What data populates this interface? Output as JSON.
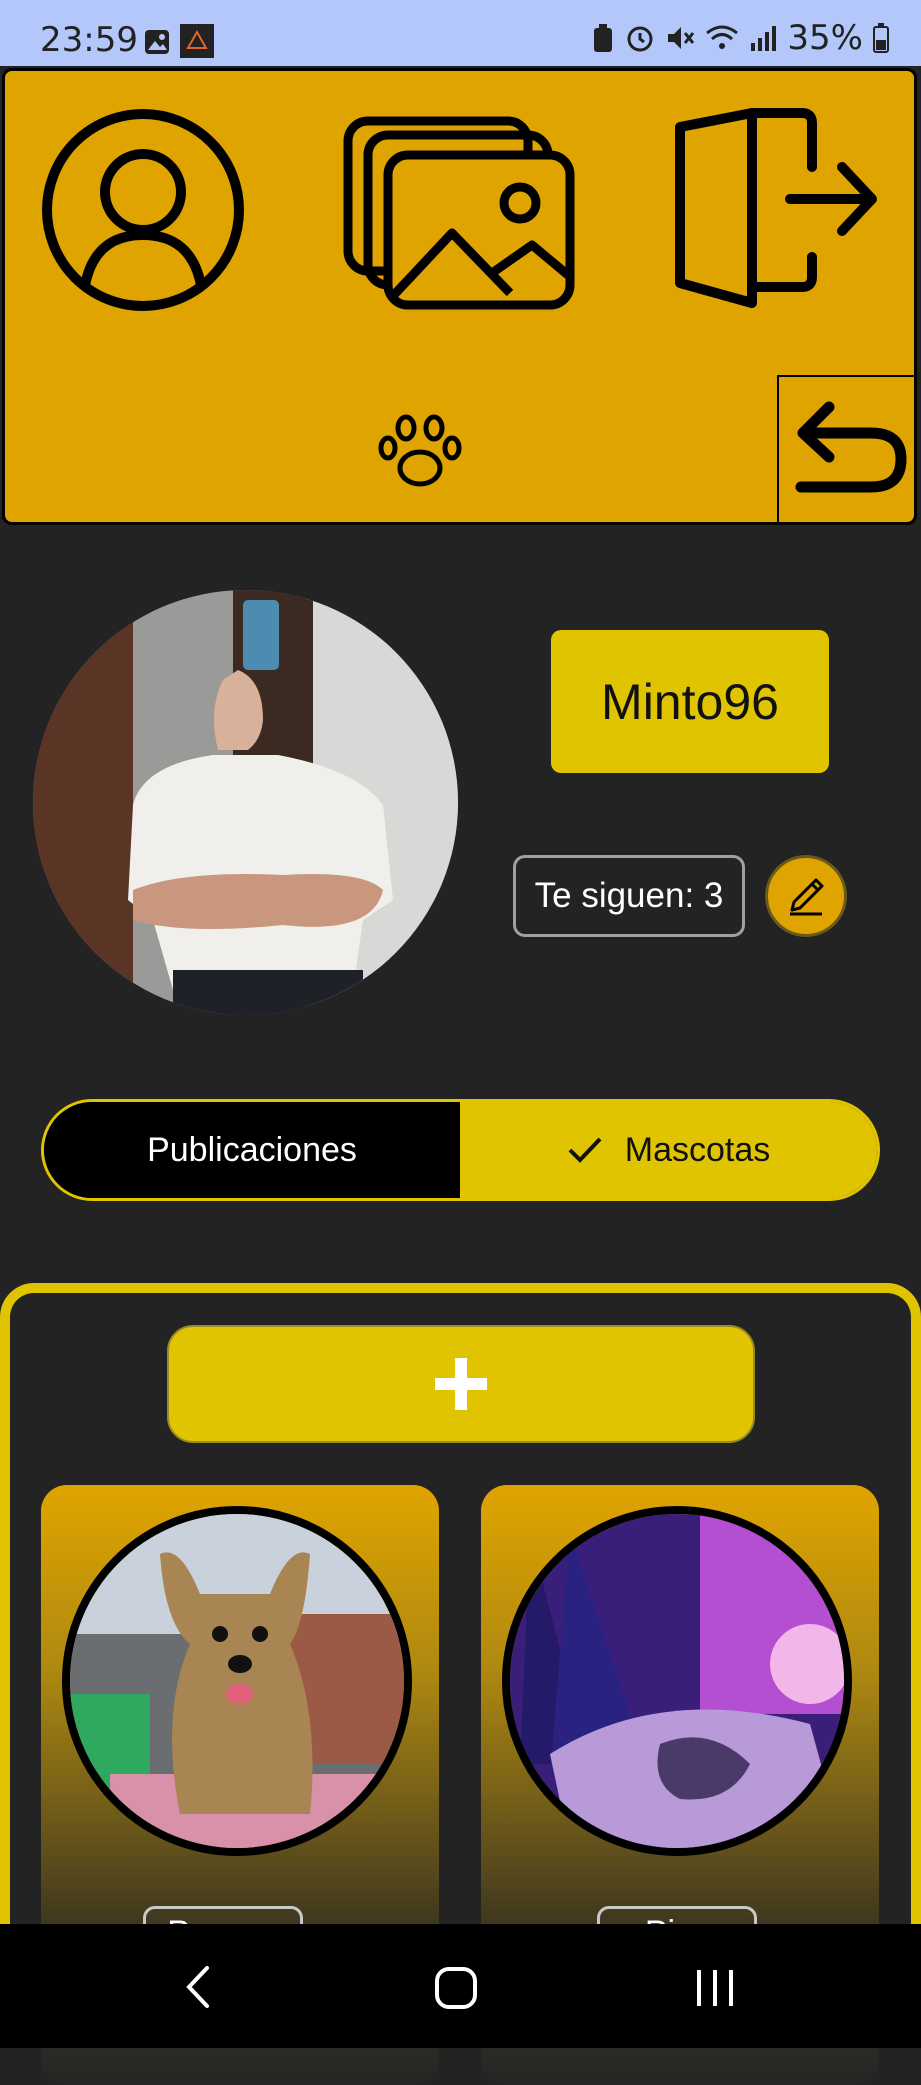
{
  "status_bar": {
    "time": "23:59",
    "battery_percent": "35%",
    "icons_left": [
      "gallery-icon",
      "app-notification-icon"
    ],
    "icons_right": [
      "battery-saver-icon",
      "alarm-icon",
      "mute-icon",
      "wifi-icon",
      "signal-icon",
      "battery-icon"
    ]
  },
  "header": {
    "icons": [
      "profile-icon",
      "gallery-icon",
      "logout-icon",
      "paw-icon",
      "back-icon"
    ],
    "accent_color": "#e0a400"
  },
  "profile": {
    "username": "Minto96",
    "followers_label": "Te siguen: 3"
  },
  "tabs": {
    "publications": "Publicaciones",
    "pets": "Mascotas",
    "selected": "Mascotas"
  },
  "pets": {
    "add_label": "+",
    "items": [
      {
        "name": "Peca…"
      },
      {
        "name": "Pi…"
      }
    ]
  },
  "colors": {
    "background": "#232323",
    "yellow": "#e0c400",
    "orange": "#e0a400",
    "status_bar": "#b3c7fb"
  }
}
